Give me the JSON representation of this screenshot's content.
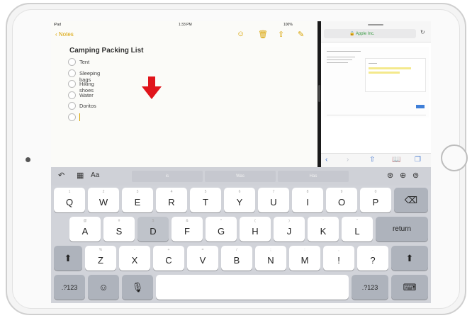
{
  "status_bar": {
    "left": "iPad",
    "time": "1:33 PM",
    "battery": "100%"
  },
  "notes": {
    "back_label": "Notes",
    "title": "Camping Packing List",
    "items": [
      "Tent",
      "Sleeping bags",
      "Hiking shoes",
      "Water",
      "Doritos"
    ],
    "toolbar_icons": [
      "share-people-icon",
      "trash-icon",
      "share-icon",
      "compose-icon"
    ]
  },
  "safari": {
    "url": "Apple Inc.",
    "lock_icon": "lock-icon",
    "reload_icon": "reload-icon",
    "bottom_icons": [
      "back-icon",
      "forward-icon",
      "share-icon",
      "bookmarks-icon",
      "tabs-icon"
    ]
  },
  "keyboard": {
    "shortcut_left": [
      "undo-icon",
      "table-icon"
    ],
    "aa_label": "Aa",
    "predictions": [
      "is",
      "Was",
      "Has"
    ],
    "shortcut_right": [
      "checklist-icon",
      "plus-icon",
      "sketch-icon"
    ],
    "row1": [
      "Q",
      "W",
      "E",
      "R",
      "T",
      "Y",
      "U",
      "I",
      "O",
      "P"
    ],
    "row1_sub": [
      "1",
      "2",
      "3",
      "4",
      "5",
      "6",
      "7",
      "8",
      "9",
      "0"
    ],
    "row2": [
      "A",
      "S",
      "D",
      "F",
      "G",
      "H",
      "J",
      "K",
      "L"
    ],
    "row2_sub": [
      "@",
      "#",
      "$",
      "&",
      "*",
      "(",
      ")",
      "'",
      "\""
    ],
    "row3": [
      "Z",
      "X",
      "C",
      "V",
      "B",
      "N",
      "M",
      "!",
      "?"
    ],
    "row3_sub": [
      "%",
      "-",
      "+",
      "=",
      "/",
      ";",
      ":",
      ",",
      "."
    ],
    "return_label": "return",
    "numbers_label": ".?123",
    "delete_icon": "delete-icon",
    "shift_icon": "shift-icon",
    "emoji_icon": "emoji-icon",
    "mic_icon": "microphone-icon",
    "dismiss_icon": "keyboard-dismiss-icon"
  },
  "annotation": {
    "arrow_color": "#e0141b",
    "arrow_icon": "down-arrow-icon"
  },
  "colors": {
    "notes_accent": "#d9a300",
    "keyboard_bg": "#d1d3d9",
    "safari_green": "#3a9b43"
  }
}
